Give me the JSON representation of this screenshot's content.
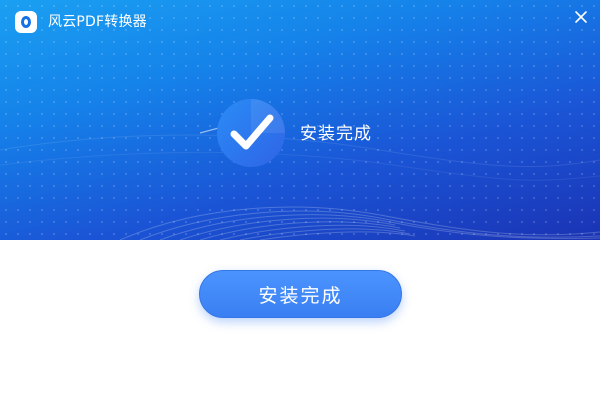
{
  "window": {
    "title": "风云PDF转换器",
    "icons": {
      "app_logo": "app-logo-icon",
      "close": "close-icon",
      "status": "checkmark-icon"
    }
  },
  "status": {
    "message": "安装完成"
  },
  "actions": {
    "finish_label": "安装完成"
  },
  "colors": {
    "banner_top": "#1aa0f2",
    "banner_bottom": "#1a33b4",
    "button": "#3f86f6",
    "check_circle": "#2f7bf0",
    "background": "#ffffff"
  }
}
